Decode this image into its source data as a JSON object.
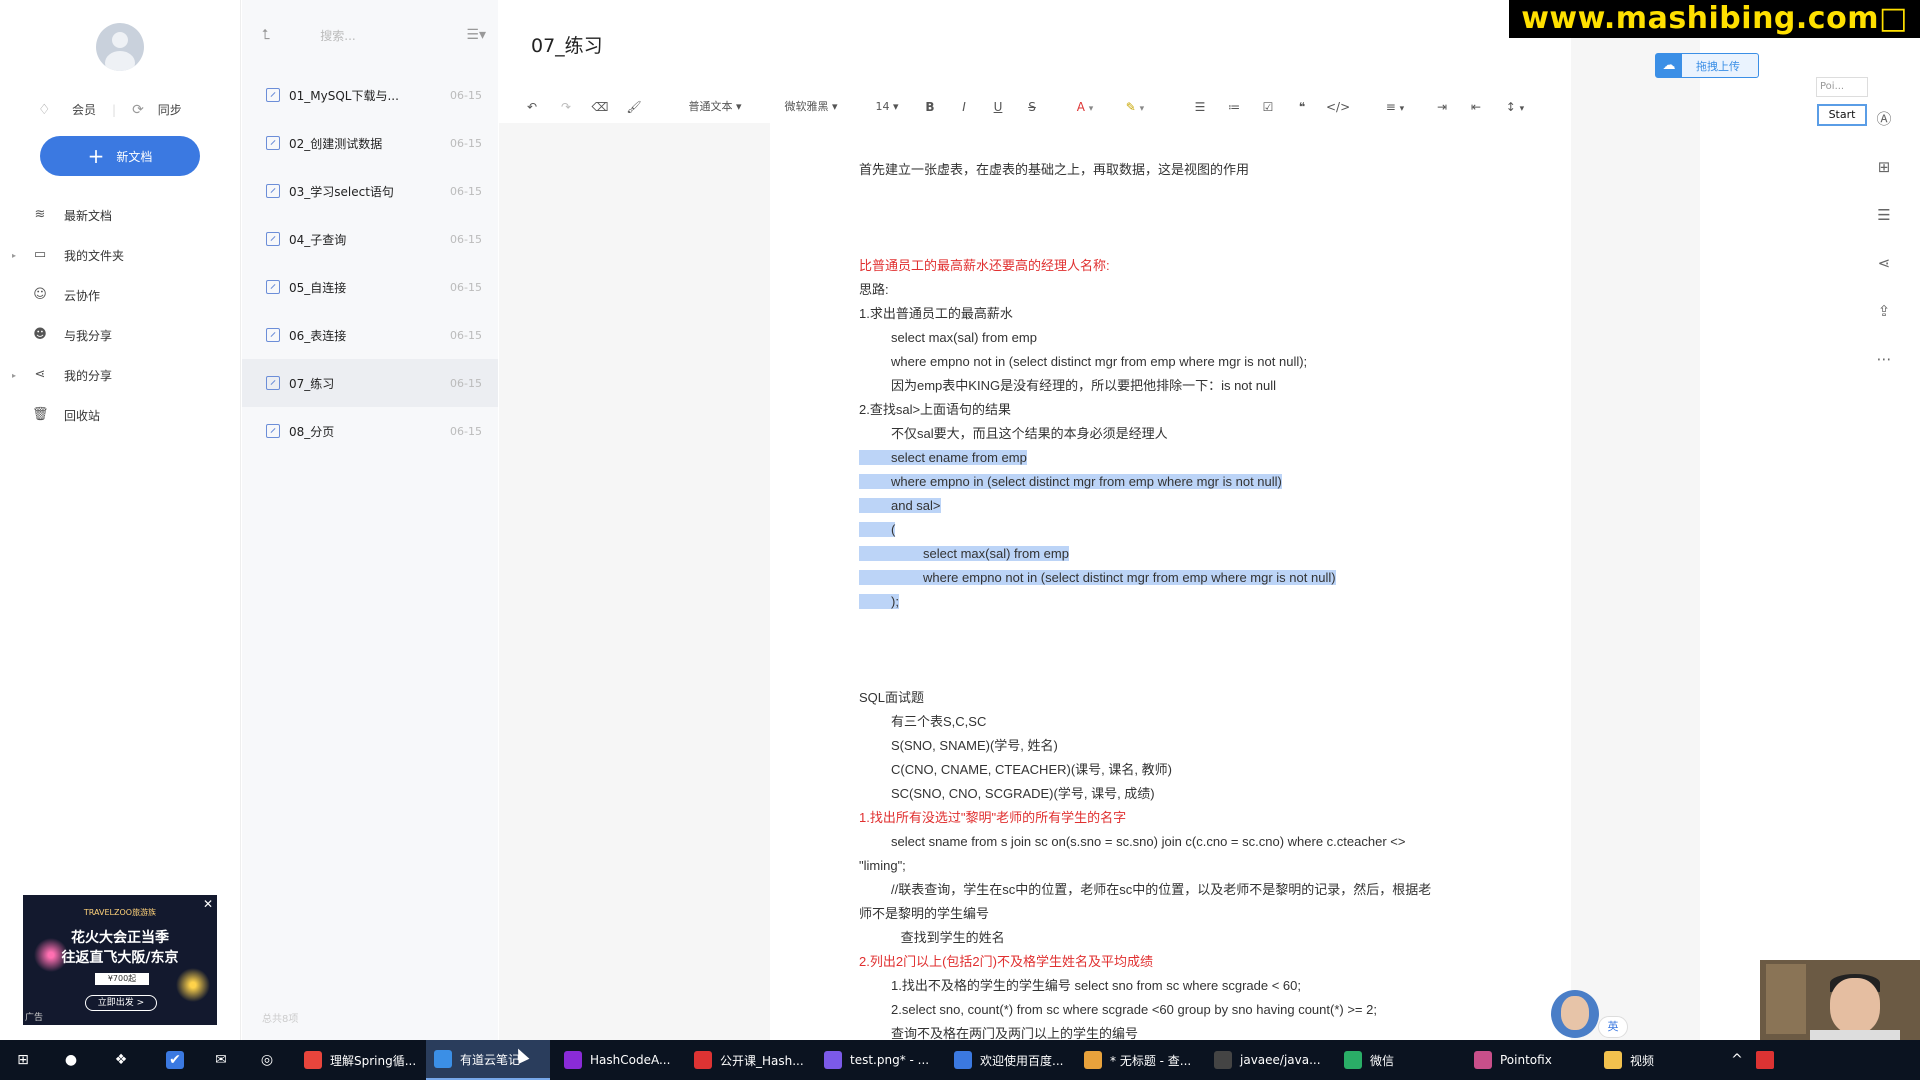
{
  "brand": "www.mashibing.com□",
  "sidebar": {
    "vip_label": "会员",
    "sync_label": "同步",
    "new_doc_label": "新文档",
    "items": [
      {
        "label": "最新文档",
        "icon": "layers-icon",
        "expandable": false
      },
      {
        "label": "我的文件夹",
        "icon": "folder-icon",
        "expandable": true
      },
      {
        "label": "云协作",
        "icon": "user-icon",
        "expandable": false
      },
      {
        "label": "与我分享",
        "icon": "shared-user-icon",
        "expandable": false
      },
      {
        "label": "我的分享",
        "icon": "share-icon",
        "expandable": true
      },
      {
        "label": "回收站",
        "icon": "trash-icon",
        "expandable": false
      }
    ],
    "ad": {
      "logo": "TRAVELZOO旅游族",
      "line1": "花火大会正当季",
      "line2": "往返直飞大阪/东京",
      "price": "¥700起",
      "cta": "立即出发 >",
      "tag": "广告"
    }
  },
  "doclist": {
    "search_placeholder": "搜索...",
    "items": [
      {
        "name": "01_MySQL下载与...",
        "date": "06-15",
        "active": false
      },
      {
        "name": "02_创建测试数据",
        "date": "06-15",
        "active": false
      },
      {
        "name": "03_学习select语句",
        "date": "06-15",
        "active": false
      },
      {
        "name": "04_子查询",
        "date": "06-15",
        "active": false
      },
      {
        "name": "05_自连接",
        "date": "06-15",
        "active": false
      },
      {
        "name": "06_表连接",
        "date": "06-15",
        "active": false
      },
      {
        "name": "07_练习",
        "date": "06-15",
        "active": true
      },
      {
        "name": "08_分页",
        "date": "06-15",
        "active": false
      }
    ],
    "footer": "总共8项"
  },
  "editor": {
    "title": "07_练习",
    "toolbar": {
      "style": "普通文本",
      "font": "微软雅黑",
      "size": "14"
    },
    "lines": [
      {
        "text": "首先建立一张虚表，在虚表的基础之上，再取数据，这是视图的作用",
        "indent": 0,
        "red": false,
        "hl": false
      },
      {
        "text": "比普通员工的最高薪水还要高的经理人名称:",
        "indent": 0,
        "red": true,
        "hl": false
      },
      {
        "text": "思路:",
        "indent": 0,
        "red": false,
        "hl": false
      },
      {
        "text": "1.求出普通员工的最高薪水",
        "indent": 0,
        "red": false,
        "hl": false
      },
      {
        "text": "select max(sal) from emp",
        "indent": 1,
        "red": false,
        "hl": false
      },
      {
        "text": "where empno not in (select distinct mgr from emp where mgr is not null);",
        "indent": 1,
        "red": false,
        "hl": false
      },
      {
        "text": "因为emp表中KING是没有经理的，所以要把他排除一下：is not null",
        "indent": 1,
        "red": false,
        "hl": false
      },
      {
        "text": "2.查找sal>上面语句的结果",
        "indent": 0,
        "red": false,
        "hl": false
      },
      {
        "text": "不仅sal要大，而且这个结果的本身必须是经理人",
        "indent": 1,
        "red": false,
        "hl": false
      },
      {
        "text": "select ename from emp",
        "indent": 1,
        "red": false,
        "hl": true
      },
      {
        "text": "where empno in (select distinct mgr from emp where mgr is not null)",
        "indent": 1,
        "red": false,
        "hl": true
      },
      {
        "text": "and sal>",
        "indent": 1,
        "red": false,
        "hl": true
      },
      {
        "text": "(",
        "indent": 1,
        "red": false,
        "hl": true
      },
      {
        "text": "select max(sal) from emp",
        "indent": 2,
        "red": false,
        "hl": true
      },
      {
        "text": "where empno not in (select distinct mgr from emp where mgr is not null)",
        "indent": 2,
        "red": false,
        "hl": true
      },
      {
        "text": ");",
        "indent": 1,
        "red": false,
        "hl": true
      },
      {
        "text": "SQL面试题",
        "indent": 0,
        "red": false,
        "hl": false
      },
      {
        "text": "有三个表S,C,SC",
        "indent": 1,
        "red": false,
        "hl": false
      },
      {
        "text": "S(SNO, SNAME)(学号, 姓名)",
        "indent": 1,
        "red": false,
        "hl": false
      },
      {
        "text": "C(CNO, CNAME, CTEACHER)(课号, 课名, 教师)",
        "indent": 1,
        "red": false,
        "hl": false
      },
      {
        "text": "SC(SNO, CNO, SCGRADE)(学号, 课号, 成绩)",
        "indent": 1,
        "red": false,
        "hl": false
      },
      {
        "text": "1.找出所有没选过\"黎明\"老师的所有学生的名字",
        "indent": 0,
        "red": true,
        "hl": false
      },
      {
        "text": "select sname from s join sc on(s.sno = sc.sno) join c(c.cno = sc.cno) where c.cteacher <>",
        "indent": 1,
        "red": false,
        "hl": false
      },
      {
        "text": "\"liming\";",
        "indent": 0,
        "red": false,
        "hl": false
      },
      {
        "text": "//联表查询，学生在sc中的位置，老师在sc中的位置，以及老师不是黎明的记录，然后，根据老",
        "indent": 1,
        "red": false,
        "hl": false
      },
      {
        "text": "师不是黎明的学生编号",
        "indent": 0,
        "red": false,
        "hl": false
      },
      {
        "text": "查找到学生的姓名",
        "indent": 1.3,
        "red": false,
        "hl": false
      },
      {
        "text": "2.列出2门以上(包括2门)不及格学生姓名及平均成绩",
        "indent": 0,
        "red": true,
        "hl": false
      },
      {
        "text": "1.找出不及格的学生的学生编号                    select sno from sc where scgrade < 60;",
        "indent": 1,
        "red": false,
        "hl": false
      },
      {
        "text": "2.select sno, count(*) from sc where scgrade <60 group by sno having count(*) >= 2;",
        "indent": 1,
        "red": false,
        "hl": false
      },
      {
        "text": "查询不及格在两门及两门以上的学生的编号",
        "indent": 1,
        "red": false,
        "hl": false
      }
    ]
  },
  "upload_label": "拖拽上传",
  "overlay": {
    "poi": "Poi...",
    "start": "Start",
    "ime": "英"
  },
  "taskbar": {
    "items": [
      {
        "label": "理解Spring循...",
        "color": "#e8453c"
      },
      {
        "label": "有道云笔记",
        "color": "#3b8fe6"
      },
      {
        "label": "HashCodeA...",
        "color": "#8a2bd8"
      },
      {
        "label": "公开课_Hash...",
        "color": "#d33"
      },
      {
        "label": "test.png* - ...",
        "color": "#7b5ae8"
      },
      {
        "label": "欢迎使用百度...",
        "color": "#3b79e1"
      },
      {
        "label": "* 无标题 - 查...",
        "color": "#e8a23c"
      },
      {
        "label": "javaee/java...",
        "color": "#444"
      },
      {
        "label": "微信",
        "color": "#2aae67"
      },
      {
        "label": "Pointofix",
        "color": "#c94f8a"
      },
      {
        "label": "视频",
        "color": "#f2c14e"
      }
    ]
  }
}
